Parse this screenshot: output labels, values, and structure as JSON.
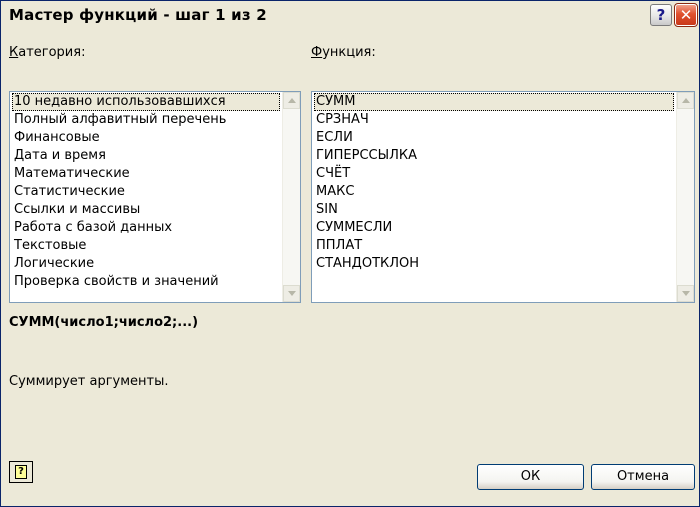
{
  "window": {
    "title": "Мастер функций - шаг 1 из 2",
    "help_glyph": "?",
    "close_glyph": "✕"
  },
  "category": {
    "label_underlined": "К",
    "label_rest": "атегория:",
    "items": [
      "10 недавно использовавшихся",
      "Полный алфавитный перечень",
      "Финансовые",
      "Дата и время",
      "Математические",
      "Статистические",
      "Ссылки и массивы",
      "Работа с базой данных",
      "Текстовые",
      "Логические",
      "Проверка свойств и значений"
    ],
    "selected_index": 0
  },
  "function": {
    "label_underlined": "Ф",
    "label_rest": "ункция:",
    "items": [
      "СУММ",
      "СРЗНАЧ",
      "ЕСЛИ",
      "ГИПЕРССЫЛКА",
      "СЧЁТ",
      "МАКС",
      "SIN",
      "СУММЕСЛИ",
      "ППЛАТ",
      "СТАНДОТКЛОН"
    ],
    "selected_index": 0
  },
  "syntax": "СУММ(число1;число2;...)",
  "description": "Суммирует аргументы.",
  "buttons": {
    "help_glyph": "?",
    "ok": "ОК",
    "cancel": "Отмена"
  },
  "colors": {
    "close_button": "#e0512e",
    "dialog_background": "#ece9d8",
    "listbox_border": "#7f9db9"
  }
}
